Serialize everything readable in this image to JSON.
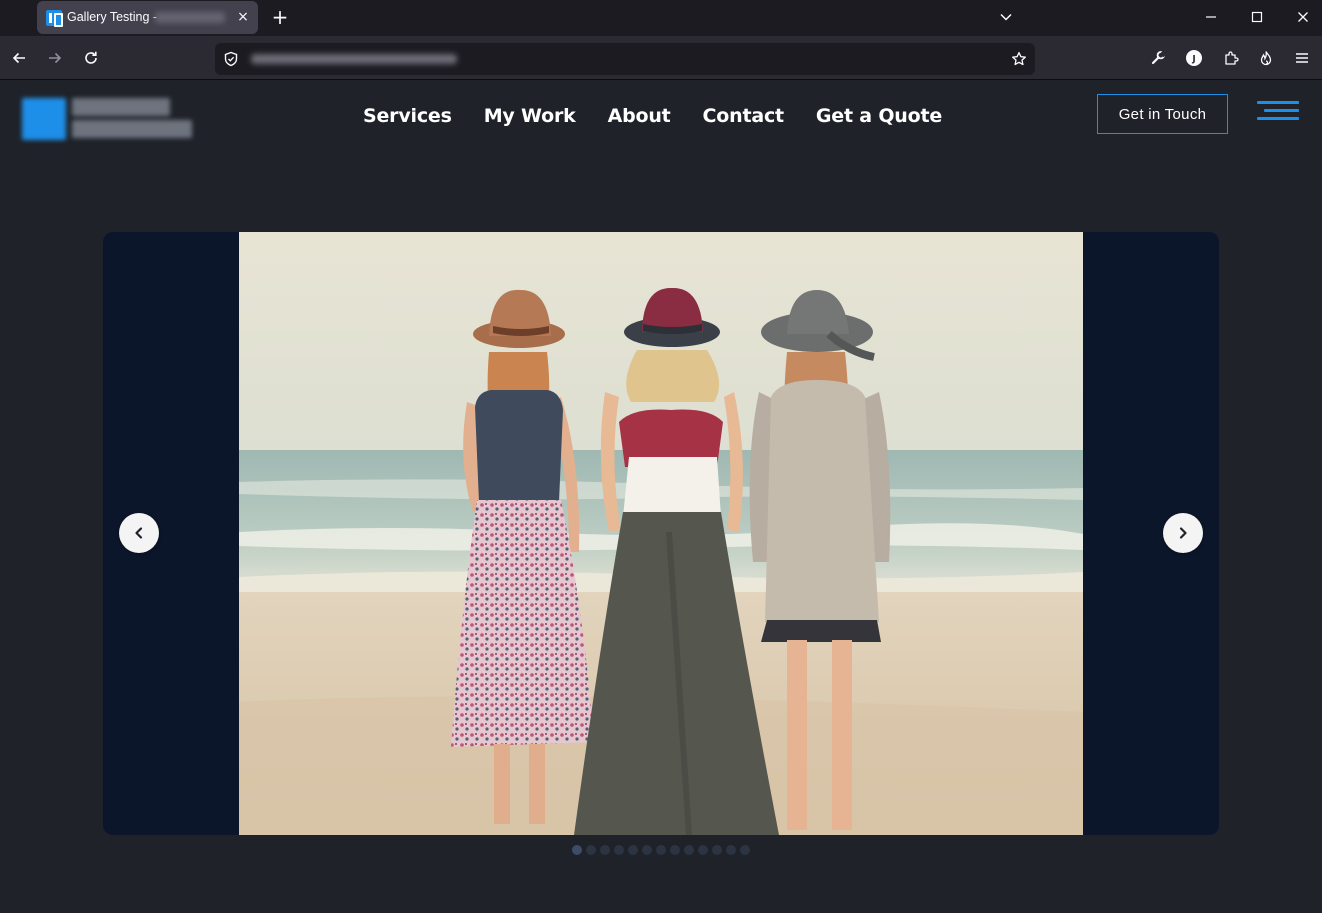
{
  "browser": {
    "tab": {
      "title": "Gallery Testing -",
      "favicon": "site-logo-icon",
      "close": "×"
    },
    "new_tab": "+",
    "icons": [
      "back-icon",
      "forward-icon",
      "reload-icon",
      "shield-icon",
      "star-icon",
      "wrench-icon",
      "account-icon",
      "extensions-icon",
      "fire-icon",
      "menu-icon",
      "minimize-icon",
      "maximize-icon",
      "close-window-icon",
      "tab-list-icon"
    ]
  },
  "site": {
    "nav": [
      "Services",
      "My Work",
      "About",
      "Contact",
      "Get a Quote"
    ],
    "cta": "Get in Touch",
    "accent": "#1e8fe8"
  },
  "gallery": {
    "image": "Three women wearing hats standing on a beach facing the sea",
    "dot_count": 13,
    "active_dot": 0,
    "prev_icon": "chevron-left-icon",
    "next_icon": "chevron-right-icon"
  }
}
